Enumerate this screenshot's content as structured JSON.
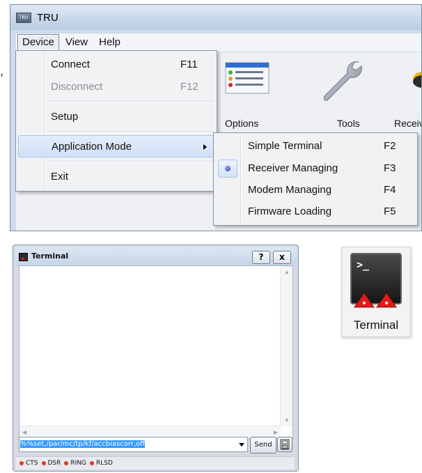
{
  "app": {
    "title": "TRU",
    "icon_text": "TRU"
  },
  "menubar": [
    "Device",
    "View",
    "Help"
  ],
  "toolbar": [
    {
      "label": "Options",
      "icon": "options-icon"
    },
    {
      "label": "Tools",
      "icon": "wrench-icon"
    },
    {
      "label": "Receiv",
      "icon": "receiver-icon"
    }
  ],
  "device_menu": {
    "items": [
      {
        "label": "Connect",
        "shortcut": "F11",
        "disabled": false
      },
      {
        "label": "Disconnect",
        "shortcut": "F12",
        "disabled": true
      },
      {
        "label": "Setup",
        "shortcut": "",
        "disabled": false
      },
      {
        "label": "Application Mode",
        "shortcut": "",
        "has_submenu": true,
        "highlighted": true
      },
      {
        "label": "Exit",
        "shortcut": "",
        "disabled": false
      }
    ]
  },
  "application_mode_submenu": {
    "items": [
      {
        "label": "Simple Terminal",
        "shortcut": "F2",
        "selected": false
      },
      {
        "label": "Receiver Managing",
        "shortcut": "F3",
        "selected": true
      },
      {
        "label": "Modem Managing",
        "shortcut": "F4",
        "selected": false
      },
      {
        "label": "Firmware Loading",
        "shortcut": "F5",
        "selected": false
      }
    ]
  },
  "terminal_window": {
    "title": "Terminal",
    "help_button": "?",
    "close_button": "x",
    "command_value": "%%set,/par/mc/tp/kf/accbiascorr,off",
    "send_label": "Send",
    "status": [
      "CTS",
      "DSR",
      "RING",
      "RLSD"
    ],
    "status_color": "#e03a1e"
  },
  "terminal_tile": {
    "label": "Terminal",
    "prompt": ">_"
  },
  "stray_punctuation": ","
}
